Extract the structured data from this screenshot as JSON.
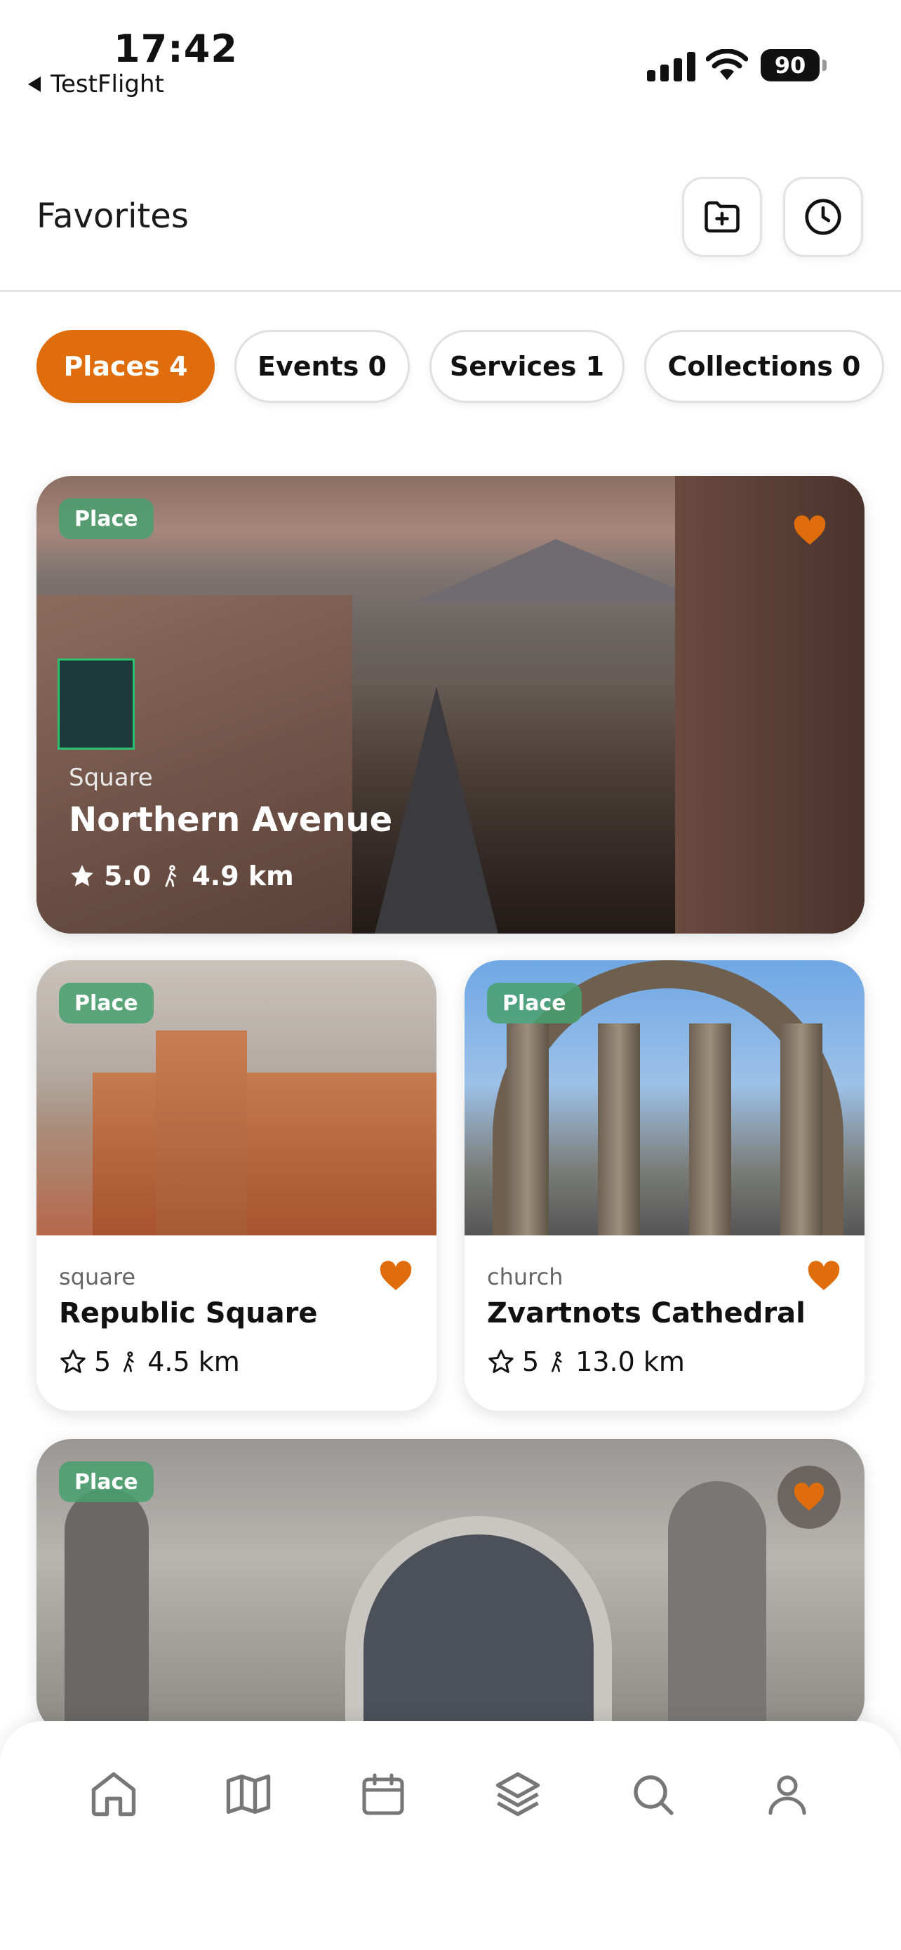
{
  "status_bar": {
    "time": "17:42",
    "back_label": "TestFlight",
    "battery": "90"
  },
  "header": {
    "title": "Favorites",
    "icons": [
      "folder-plus-icon",
      "clock-icon"
    ]
  },
  "tabs": [
    {
      "label": "Places 4",
      "active": true
    },
    {
      "label": "Events 0",
      "active": false
    },
    {
      "label": "Services 1",
      "active": false
    },
    {
      "label": "Collections 0",
      "active": false
    }
  ],
  "cards": [
    {
      "badge": "Place",
      "category": "Square",
      "name": "Northern Avenue",
      "rating": "5.0",
      "distance": "4.9 km",
      "favorited": true
    },
    {
      "badge": "Place",
      "category": "square",
      "name": "Republic Square",
      "rating": "5",
      "distance": "4.5 km",
      "favorited": true
    },
    {
      "badge": "Place",
      "category": "church",
      "name": "Zvartnots Cathedral",
      "rating": "5",
      "distance": "13.0 km",
      "favorited": true
    },
    {
      "badge": "Place",
      "favorited": true
    }
  ],
  "bottom_nav": [
    "home-icon",
    "map-icon",
    "calendar-icon",
    "layers-icon",
    "search-icon",
    "user-icon"
  ],
  "colors": {
    "accent": "#e06d0b",
    "badge": "#48a06e"
  }
}
